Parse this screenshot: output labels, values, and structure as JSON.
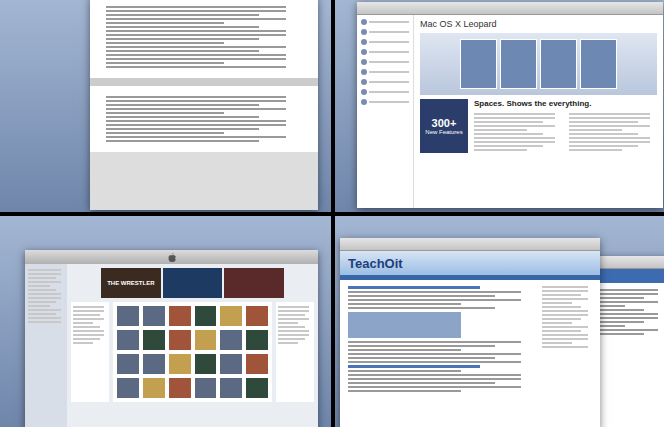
{
  "spaces": [
    {
      "kind": "document"
    },
    {
      "kind": "apple-site",
      "title": "Mac OS X Leopard",
      "heading": "Spaces. Shows the everything.",
      "badge_number": "300+",
      "badge_label": "New Features"
    },
    {
      "kind": "itunes",
      "banner": "THE WRESTLER"
    },
    {
      "kind": "blog",
      "logo": "TeachOit"
    }
  ]
}
